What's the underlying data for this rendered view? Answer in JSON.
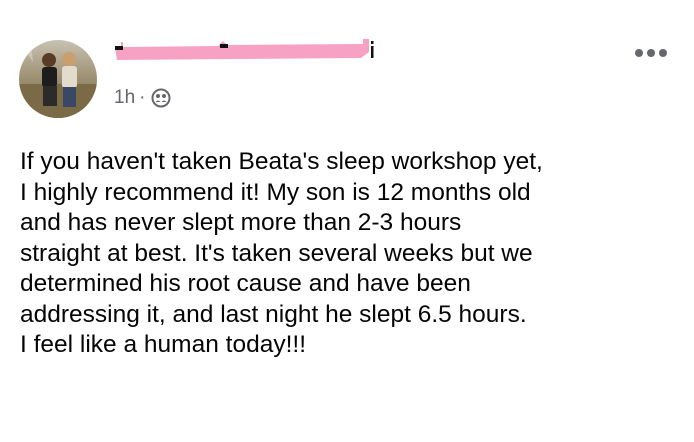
{
  "post": {
    "author": {
      "avatar_icon": "profile-photo-avatar",
      "name_visible_fragment": "i",
      "name_redacted": true,
      "redaction_color": "#f7a1c4"
    },
    "timestamp": "1h",
    "separator": "·",
    "audience_icon": "friends-icon",
    "more_icon": "more-options-icon",
    "text": "If you haven't taken Beata's sleep workshop yet,\nI highly recommend it! My son is 12 months old\nand has never slept more than 2-3 hours\nstraight at best. It's taken several weeks but we\ndetermined his root cause and have been\naddressing it, and last night he slept 6.5 hours.\nI feel like a human today!!!"
  },
  "colors": {
    "text_primary": "#050505",
    "text_secondary": "#65676b",
    "background": "#ffffff"
  }
}
